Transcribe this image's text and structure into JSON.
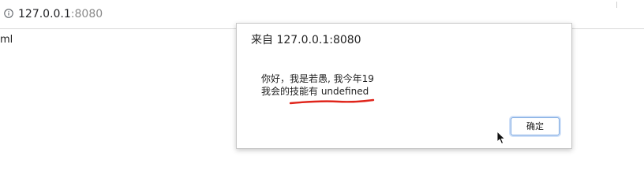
{
  "address_bar": {
    "host": "127.0.0.1",
    "port": ":8080",
    "icon": "info-icon"
  },
  "page": {
    "fragment_text": "ml"
  },
  "dialog": {
    "title": "来自 127.0.0.1:8080",
    "message_line1": "你好，我是若愚, 我今年19",
    "message_line2": "我会的技能有 undefined",
    "ok_label": "确定"
  },
  "colors": {
    "annotation_underline": "#e0251b",
    "button_border": "#7aa7e0"
  },
  "icons": {
    "cursor": "arrow-cursor-icon",
    "underline": "red-underline-annotation"
  }
}
